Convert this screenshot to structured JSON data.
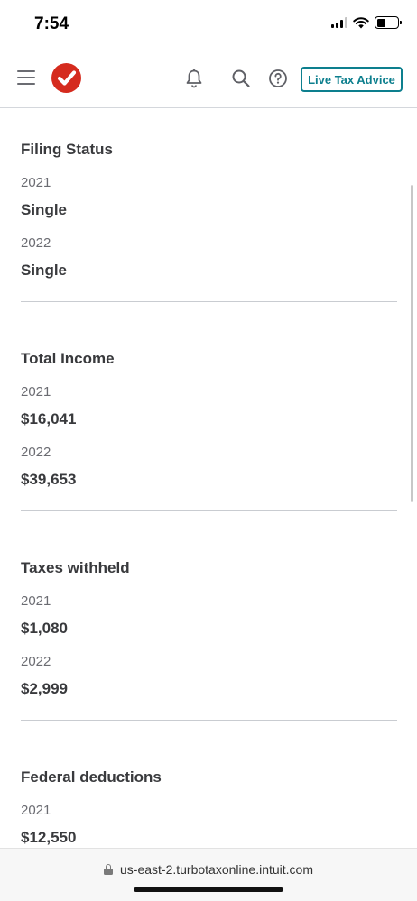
{
  "status_bar": {
    "time": "7:54"
  },
  "header": {
    "live_advice_label": "Live Tax Advice"
  },
  "sections": [
    {
      "title": "Filing Status",
      "rows": [
        {
          "year": "2021",
          "value": "Single"
        },
        {
          "year": "2022",
          "value": "Single"
        }
      ]
    },
    {
      "title": "Total Income",
      "rows": [
        {
          "year": "2021",
          "value": "$16,041"
        },
        {
          "year": "2022",
          "value": "$39,653"
        }
      ]
    },
    {
      "title": "Taxes withheld",
      "rows": [
        {
          "year": "2021",
          "value": "$1,080"
        },
        {
          "year": "2022",
          "value": "$2,999"
        }
      ]
    },
    {
      "title": "Federal deductions",
      "rows": [
        {
          "year": "2021",
          "value": "$12,550"
        }
      ]
    }
  ],
  "browser": {
    "url": "us-east-2.turbotaxonline.intuit.com"
  },
  "colors": {
    "brand_red": "#d52b1e",
    "accent_teal": "#0d7f8e",
    "text": "#393a3d",
    "muted": "#6b6c72"
  },
  "icons": [
    "menu-icon",
    "turbotax-logo",
    "bell-icon",
    "search-icon",
    "help-icon",
    "lock-icon"
  ]
}
